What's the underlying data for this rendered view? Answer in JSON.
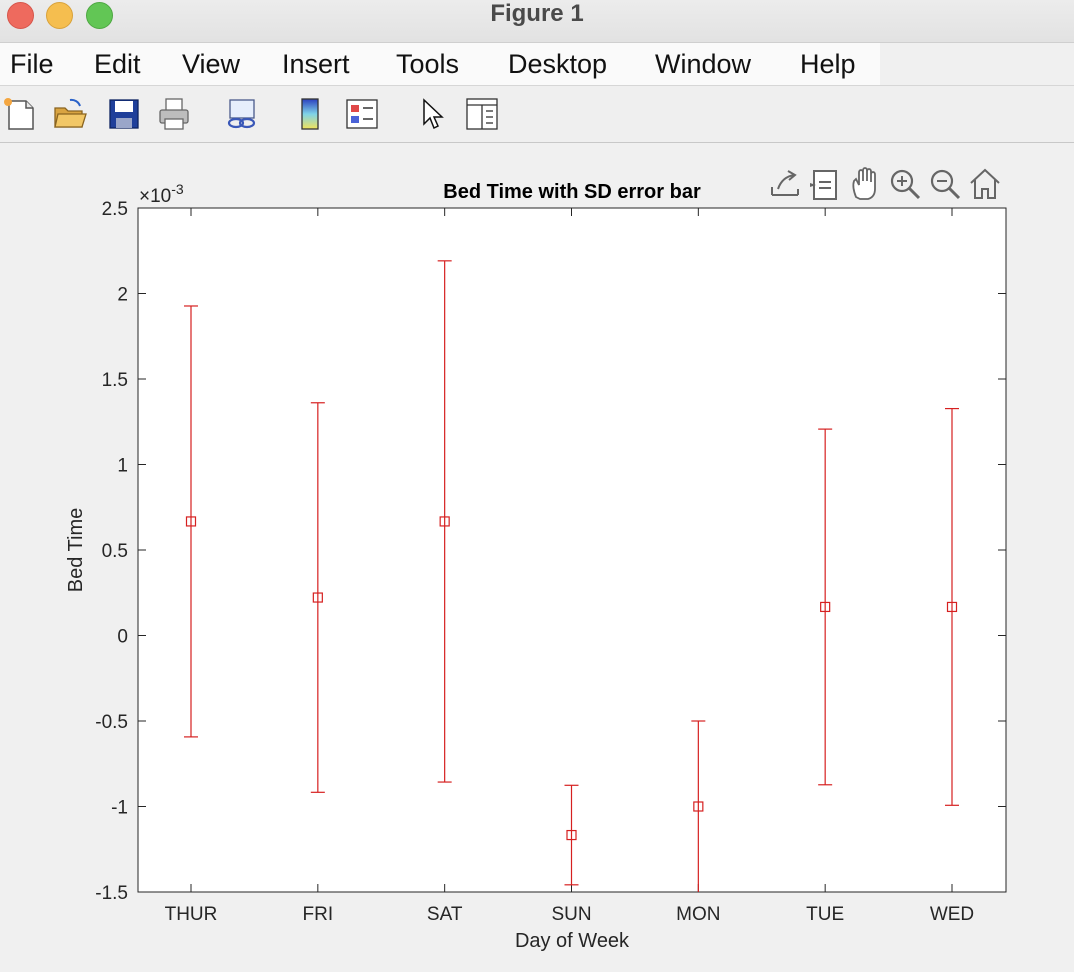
{
  "window": {
    "title": "Figure 1"
  },
  "menu": {
    "items": [
      {
        "label": "File"
      },
      {
        "label": "Edit"
      },
      {
        "label": "View"
      },
      {
        "label": "Insert"
      },
      {
        "label": "Tools"
      },
      {
        "label": "Desktop"
      },
      {
        "label": "Window"
      },
      {
        "label": "Help"
      }
    ]
  },
  "toolbar": {
    "icons": [
      "new-figure-icon",
      "open-file-icon",
      "save-icon",
      "print-icon",
      "link-plot-icon",
      "colorbar-icon",
      "legend-icon",
      "edit-plot-icon",
      "property-inspector-icon"
    ]
  },
  "axes_toolbar": {
    "icons": [
      "export-icon",
      "brush-icon",
      "pan-icon",
      "zoom-in-icon",
      "zoom-out-icon",
      "home-icon"
    ]
  },
  "colors": {
    "series": "#d62020",
    "axis": "#262626"
  },
  "chart_data": {
    "type": "errorbar",
    "title": "Bed Time with SD error bar",
    "xlabel": "Day of Week",
    "ylabel": "Bed Time",
    "exponent_label": "×10",
    "exponent_power": "-3",
    "categories": [
      "THUR",
      "FRI",
      "SAT",
      "SUN",
      "MON",
      "TUE",
      "WED"
    ],
    "ylim": [
      -1.5,
      2.5
    ],
    "yticks": [
      -1.5,
      -1,
      -0.5,
      0,
      0.5,
      1,
      1.5,
      2,
      2.5
    ],
    "ytick_labels": [
      "-1.5",
      "-1",
      "-0.5",
      "0",
      "0.5",
      "1",
      "1.5",
      "2",
      "2.5"
    ],
    "series": [
      {
        "mean": [
          0.667,
          0.222,
          0.667,
          -1.167,
          -1.0,
          0.167,
          0.167
        ],
        "lower": [
          -0.593,
          -0.917,
          -0.857,
          -1.458,
          -1.5,
          -0.873,
          -0.993
        ],
        "upper": [
          1.927,
          1.361,
          2.191,
          -0.876,
          -0.5,
          1.207,
          1.327
        ]
      }
    ],
    "grid": false,
    "marker": "square"
  }
}
